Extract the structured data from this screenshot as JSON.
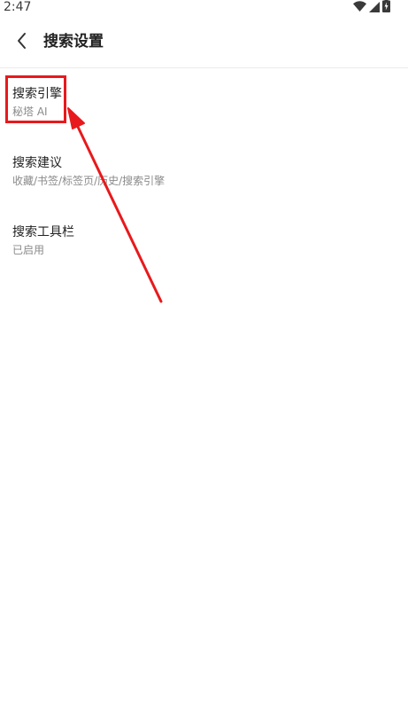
{
  "status_bar": {
    "time": "2:47",
    "icons": [
      "wifi-icon",
      "cellular-signal-icon",
      "battery-charging-icon"
    ]
  },
  "app_bar": {
    "title": "搜索设置",
    "back_icon": "chevron-left-icon"
  },
  "settings": [
    {
      "title": "搜索引擎",
      "subtitle": "秘塔 AI"
    },
    {
      "title": "搜索建议",
      "subtitle": "收藏/书签/标签页/历史/搜索引擎"
    },
    {
      "title": "搜索工具栏",
      "subtitle": "已启用"
    }
  ],
  "annotation": {
    "color": "#e8191c"
  }
}
